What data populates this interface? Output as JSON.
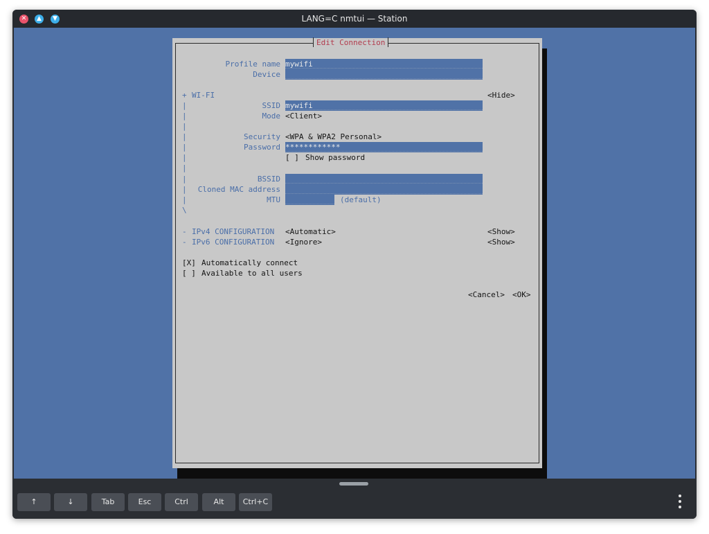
{
  "window": {
    "title": "LANG=C nmtui — Station"
  },
  "dialog": {
    "title": "Edit Connection",
    "profile_name_label": "Profile name",
    "profile_name_value": "mywifi",
    "device_label": "Device",
    "device_value": "",
    "wifi_section": {
      "marker": "+",
      "label": "WI-FI",
      "toggle": "<Hide>"
    },
    "ssid_label": "SSID",
    "ssid_value": "mywifi",
    "mode_label": "Mode",
    "mode_value": "<Client>",
    "security_label": "Security",
    "security_value": "<WPA & WPA2 Personal>",
    "password_label": "Password",
    "password_value": "************",
    "show_password": {
      "box": "[ ]",
      "label": "Show password"
    },
    "bssid_label": "BSSID",
    "bssid_value": "",
    "cloned_mac_label": "Cloned MAC address",
    "cloned_mac_value": "",
    "mtu_label": "MTU",
    "mtu_value": "",
    "mtu_default": "(default)",
    "ipv4": {
      "marker": "-",
      "label": "IPv4 CONFIGURATION",
      "value": "<Automatic>",
      "toggle": "<Show>"
    },
    "ipv6": {
      "marker": "-",
      "label": "IPv6 CONFIGURATION",
      "value": "<Ignore>",
      "toggle": "<Show>"
    },
    "auto_connect": {
      "box": "[X]",
      "label": "Automatically connect"
    },
    "all_users": {
      "box": "[ ]",
      "label": "Available to all users"
    },
    "cancel": "<Cancel>",
    "ok": "<OK>",
    "pipe": "|",
    "end": "\\"
  },
  "keys": {
    "up": "↑",
    "down": "↓",
    "tab": "Tab",
    "esc": "Esc",
    "ctrl": "Ctrl",
    "alt": "Alt",
    "ctrl_c": "Ctrl+C"
  }
}
